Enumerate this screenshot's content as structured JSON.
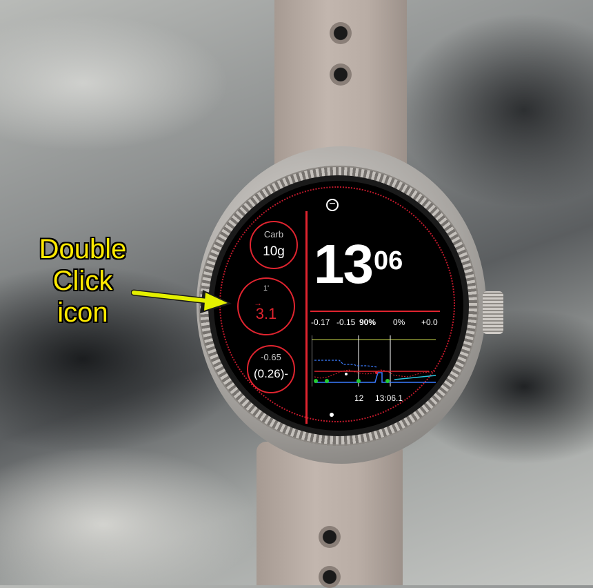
{
  "annotation": {
    "line1": "Double",
    "line2": "Click",
    "line3": "icon",
    "color": "#ffea00"
  },
  "watchface": {
    "minus_icon": "minus-circle-icon",
    "time": {
      "hour": "13",
      "minute": "06"
    },
    "complications": [
      {
        "label": "Carb",
        "value": "10g"
      },
      {
        "label": "1'",
        "value": "3.1",
        "arrow": "→",
        "value_color": "#e0242f"
      },
      {
        "label": "-0.65",
        "value": "(0.26)-"
      }
    ],
    "stats": {
      "delta1": "-0.17",
      "delta2": "-0.15",
      "percent": "90%",
      "pct2": "0%",
      "change": "+0.0"
    },
    "chart_labels": {
      "x1": "12",
      "x2": "13:06.1"
    },
    "accent_color": "#e0242f"
  }
}
